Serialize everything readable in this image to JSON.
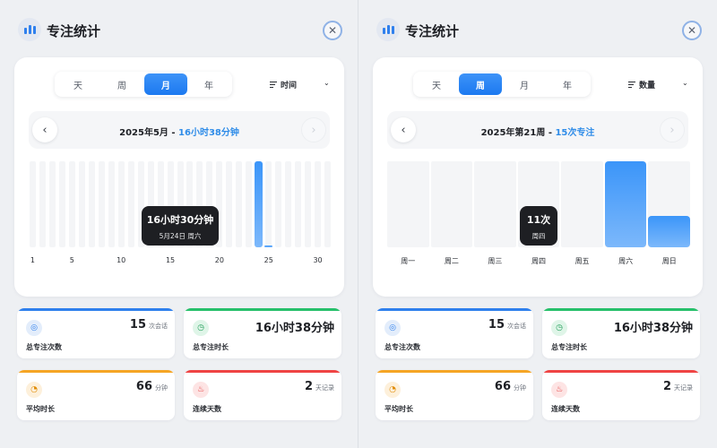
{
  "colors": {
    "accent": "#2f80ed",
    "sessions": "#2f80ed",
    "duration": "#27c06b",
    "average": "#f5a524",
    "streak": "#ef4444"
  },
  "panels": [
    {
      "title": "专注统计",
      "close_icon": "close-icon",
      "range_tabs": [
        "天",
        "周",
        "月",
        "年"
      ],
      "active_tab": 2,
      "metric": "时间",
      "period_label": "2025年5月",
      "separator": "-",
      "period_summary": "16小时38分钟",
      "tooltip": {
        "value": "16小时30分钟",
        "date": "5月24日 周六"
      },
      "stats": [
        {
          "icon": "target-icon",
          "value": "15",
          "unit": "次会话",
          "label": "总专注次数"
        },
        {
          "icon": "clock-icon",
          "value": "16小时38分钟",
          "unit": "",
          "label": "总专注时长"
        },
        {
          "icon": "timer-icon",
          "value": "66",
          "unit": "分钟",
          "label": "平均时长"
        },
        {
          "icon": "flame-icon",
          "value": "2",
          "unit": "天记录",
          "label": "连续天数"
        }
      ]
    },
    {
      "title": "专注统计",
      "close_icon": "close-icon",
      "range_tabs": [
        "天",
        "周",
        "月",
        "年"
      ],
      "active_tab": 1,
      "metric": "数量",
      "period_label": "2025年第21周",
      "separator": "-",
      "period_summary": "15次专注",
      "tooltip": {
        "value": "11次",
        "date": "周四"
      },
      "stats": [
        {
          "icon": "target-icon",
          "value": "15",
          "unit": "次会话",
          "label": "总专注次数"
        },
        {
          "icon": "clock-icon",
          "value": "16小时38分钟",
          "unit": "",
          "label": "总专注时长"
        },
        {
          "icon": "timer-icon",
          "value": "66",
          "unit": "分钟",
          "label": "平均时长"
        },
        {
          "icon": "flame-icon",
          "value": "2",
          "unit": "天记录",
          "label": "连续天数"
        }
      ]
    }
  ],
  "chart_data": [
    {
      "type": "bar",
      "x_unit": "day of month",
      "x": [
        1,
        2,
        3,
        4,
        5,
        6,
        7,
        8,
        9,
        10,
        11,
        12,
        13,
        14,
        15,
        16,
        17,
        18,
        19,
        20,
        21,
        22,
        23,
        24,
        25,
        26,
        27,
        28,
        29,
        30,
        31
      ],
      "tick_labels": [
        "1",
        "5",
        "10",
        "15",
        "20",
        "25",
        "30"
      ],
      "tick_positions": [
        1,
        5,
        10,
        15,
        20,
        25,
        30
      ],
      "y_unit": "minutes",
      "values": [
        0,
        0,
        0,
        0,
        0,
        0,
        0,
        0,
        0,
        0,
        0,
        0,
        0,
        0,
        0,
        0,
        0,
        0,
        0,
        0,
        0,
        0,
        0,
        990,
        8,
        0,
        0,
        0,
        0,
        0,
        0
      ],
      "ylim": [
        0,
        990
      ],
      "grid": false
    },
    {
      "type": "bar",
      "categories": [
        "周一",
        "周二",
        "周三",
        "周四",
        "周五",
        "周六",
        "周日"
      ],
      "values": [
        0,
        0,
        0,
        0,
        0,
        11,
        4
      ],
      "y_unit": "sessions",
      "ylim": [
        0,
        11
      ],
      "grid": false
    }
  ]
}
